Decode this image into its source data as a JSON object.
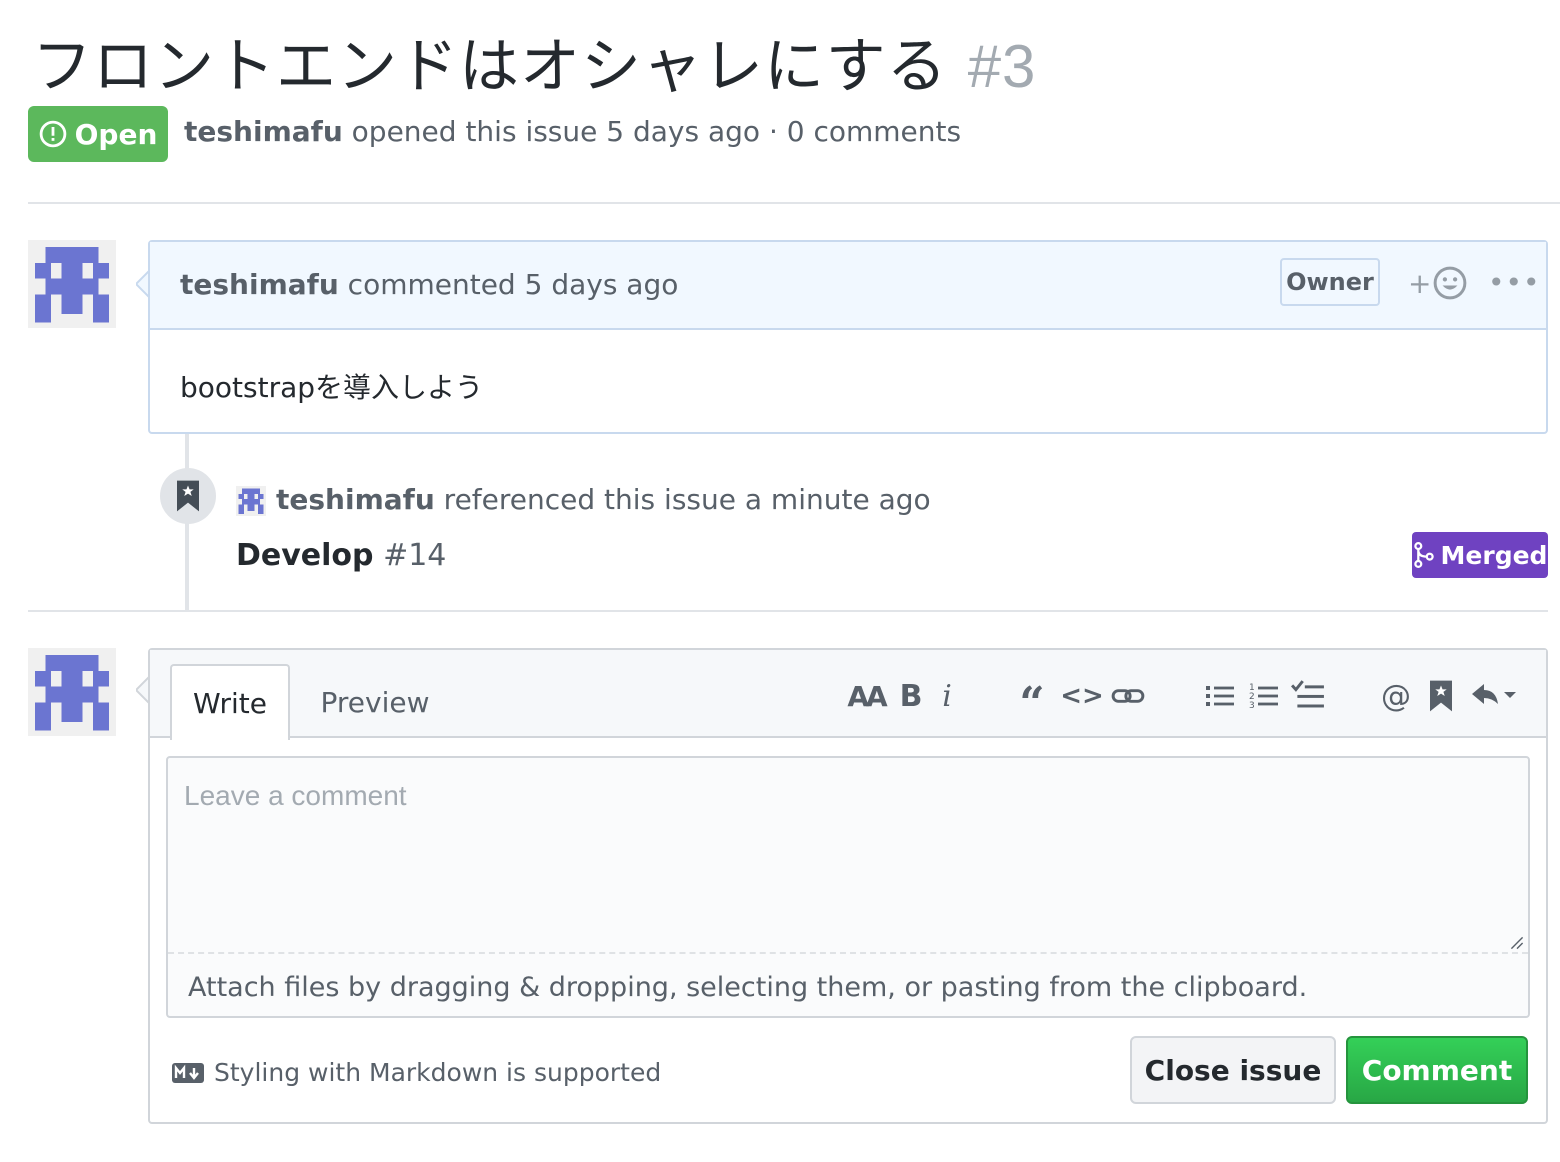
{
  "issue": {
    "title": "フロントエンドはオシャレにする",
    "number": "#3",
    "state": "Open",
    "author": "teshimafu",
    "opened_text": "opened this issue 5 days ago · 0 comments"
  },
  "comment": {
    "author": "teshimafu",
    "action": "commented 5 days ago",
    "role": "Owner",
    "reaction_label": "+",
    "more_label": "•••",
    "body": "bootstrapを導入しよう"
  },
  "reference": {
    "author": "teshimafu",
    "action": "referenced this issue a minute ago",
    "pr_title": "Develop",
    "pr_number": "#14",
    "pr_state": "Merged"
  },
  "editor": {
    "tabs": [
      "Write",
      "Preview"
    ],
    "toolbar": {
      "header": "AA",
      "bold": "B",
      "italic": "i",
      "quote": "“",
      "code": "<>",
      "mention": "@"
    },
    "placeholder": "Leave a comment",
    "attach_text": "Attach files by dragging & dropping, selecting them, or pasting from the clipboard.",
    "markdown_note": "Styling with Markdown is supported",
    "close_button": "Close issue",
    "comment_button": "Comment"
  },
  "colors": {
    "open_green": "#5cb85c",
    "merged_purple": "#6f42c1",
    "comment_green": "#28a745",
    "avatar_blue": "#6b75d1"
  },
  "icons": [
    "issue-opened-icon",
    "smiley-icon",
    "bookmark-icon",
    "git-merge-icon",
    "link-icon",
    "list-unordered-icon",
    "list-ordered-icon",
    "tasklist-icon",
    "reply-icon",
    "markdown-icon"
  ]
}
